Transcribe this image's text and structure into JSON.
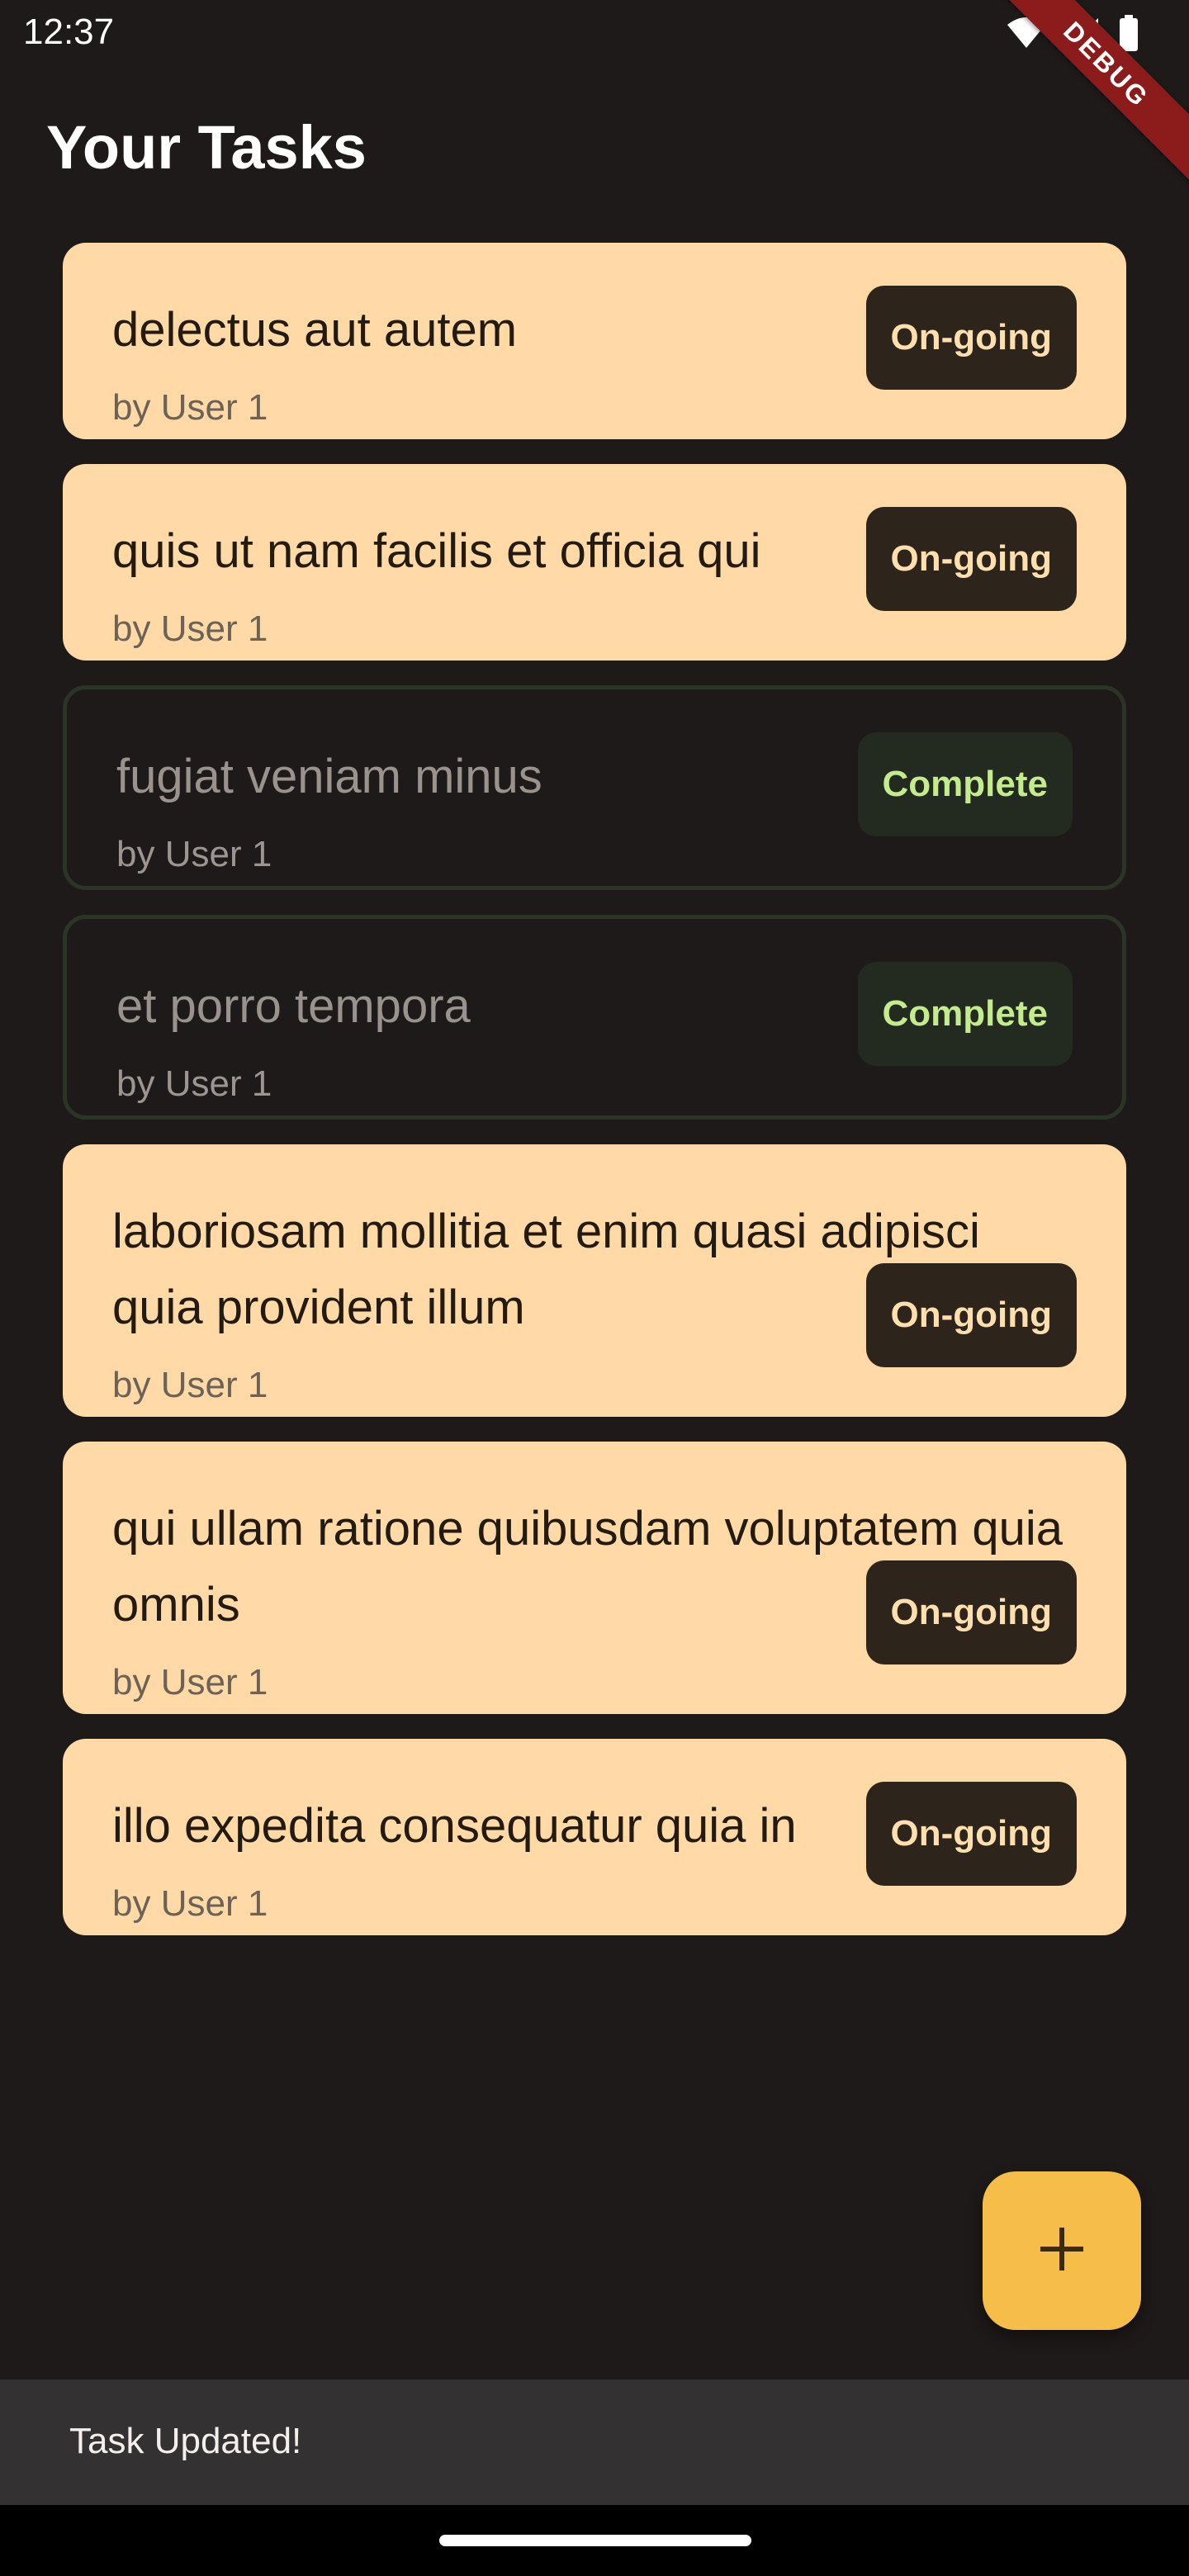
{
  "status_bar": {
    "time": "12:37",
    "icons": [
      "wifi-icon",
      "cellular-icon",
      "battery-icon"
    ]
  },
  "debug_banner": "DEBUG",
  "app_bar": {
    "title": "Your Tasks"
  },
  "tasks": [
    {
      "title": "delectus aut autem",
      "author": "by User 1",
      "status": "On-going"
    },
    {
      "title": "quis ut nam facilis et officia qui",
      "author": "by User 1",
      "status": "On-going"
    },
    {
      "title": "fugiat veniam minus",
      "author": "by User 1",
      "status": "Complete"
    },
    {
      "title": "et porro tempora",
      "author": "by User 1",
      "status": "Complete"
    },
    {
      "title": "laboriosam mollitia et enim quasi adipisci quia provident illum",
      "author": "by User 1",
      "status": "On-going"
    },
    {
      "title": "qui ullam ratione quibusdam voluptatem quia omnis",
      "author": "by User 1",
      "status": "On-going"
    },
    {
      "title": "illo expedita consequatur quia in",
      "author": "by User 1",
      "status": "On-going"
    }
  ],
  "fab": {
    "icon": "plus-icon"
  },
  "snackbar": {
    "message": "Task Updated!"
  },
  "colors": {
    "background": "#1f1a1a",
    "card_ongoing": "#ffdaa6",
    "badge_ongoing": "#2d241b",
    "badge_complete_text": "#c4ec8e",
    "fab": "#f6bd48",
    "snackbar": "#333131"
  }
}
